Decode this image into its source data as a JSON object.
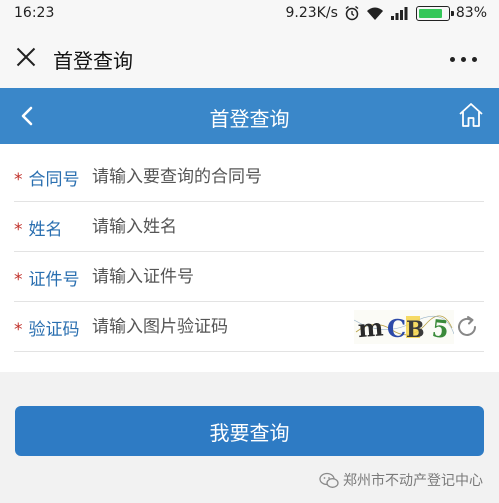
{
  "status_bar": {
    "time": "16:23",
    "network_speed": "9.23K/s",
    "battery_percent": "83%",
    "battery_level": 0.83,
    "icons": [
      "alarm-icon",
      "wifi-icon",
      "signal-icon",
      "battery-icon"
    ]
  },
  "wechat_bar": {
    "title": "首登查询",
    "close_icon": "close-icon",
    "more_icon": "more-icon"
  },
  "app_header": {
    "title": "首登查询",
    "back_icon": "chevron-left-icon",
    "home_icon": "home-icon",
    "color": "#3a87c9"
  },
  "form": {
    "rows": [
      {
        "required_mark": "*",
        "label": "合同号",
        "placeholder": "请输入要查询的合同号"
      },
      {
        "required_mark": "*",
        "label": "姓名",
        "placeholder": "请输入姓名"
      },
      {
        "required_mark": "*",
        "label": "证件号",
        "placeholder": "请输入证件号"
      },
      {
        "required_mark": "*",
        "label": "验证码",
        "placeholder": "请输入图片验证码"
      }
    ],
    "captcha_text": "mCB5",
    "refresh_icon": "refresh-icon"
  },
  "submit": {
    "label": "我要查询",
    "color": "#2e7bc4"
  },
  "watermark": {
    "text": "郑州市不动产登记中心",
    "icon": "wechat-icon"
  }
}
